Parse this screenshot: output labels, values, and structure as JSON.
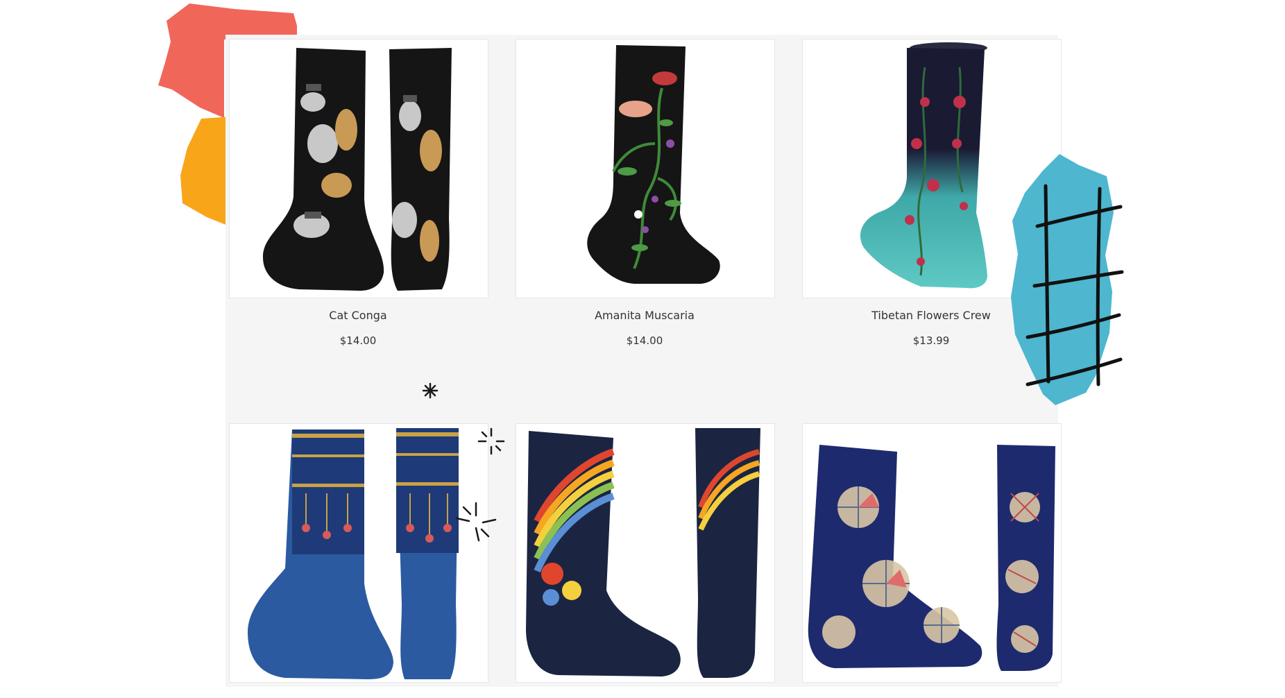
{
  "products": [
    {
      "name": "Cat Conga",
      "price": "$14.00",
      "image": "cat-conga-socks"
    },
    {
      "name": "Amanita Muscaria",
      "price": "$14.00",
      "image": "amanita-muscaria-sock"
    },
    {
      "name": "Tibetan Flowers Crew",
      "price": "$13.99",
      "image": "tibetan-flowers-crew-sock"
    },
    {
      "name": "",
      "price": "",
      "image": "blue-folk-pattern-socks"
    },
    {
      "name": "",
      "price": "",
      "image": "rainbow-arc-socks"
    },
    {
      "name": "",
      "price": "",
      "image": "stained-glass-socks"
    }
  ],
  "colors": {
    "board": "#f5f5f5",
    "coral": "#f0675a",
    "orange": "#f9a51a",
    "teal": "#4eb6cf",
    "black": "#1a1a1a"
  }
}
